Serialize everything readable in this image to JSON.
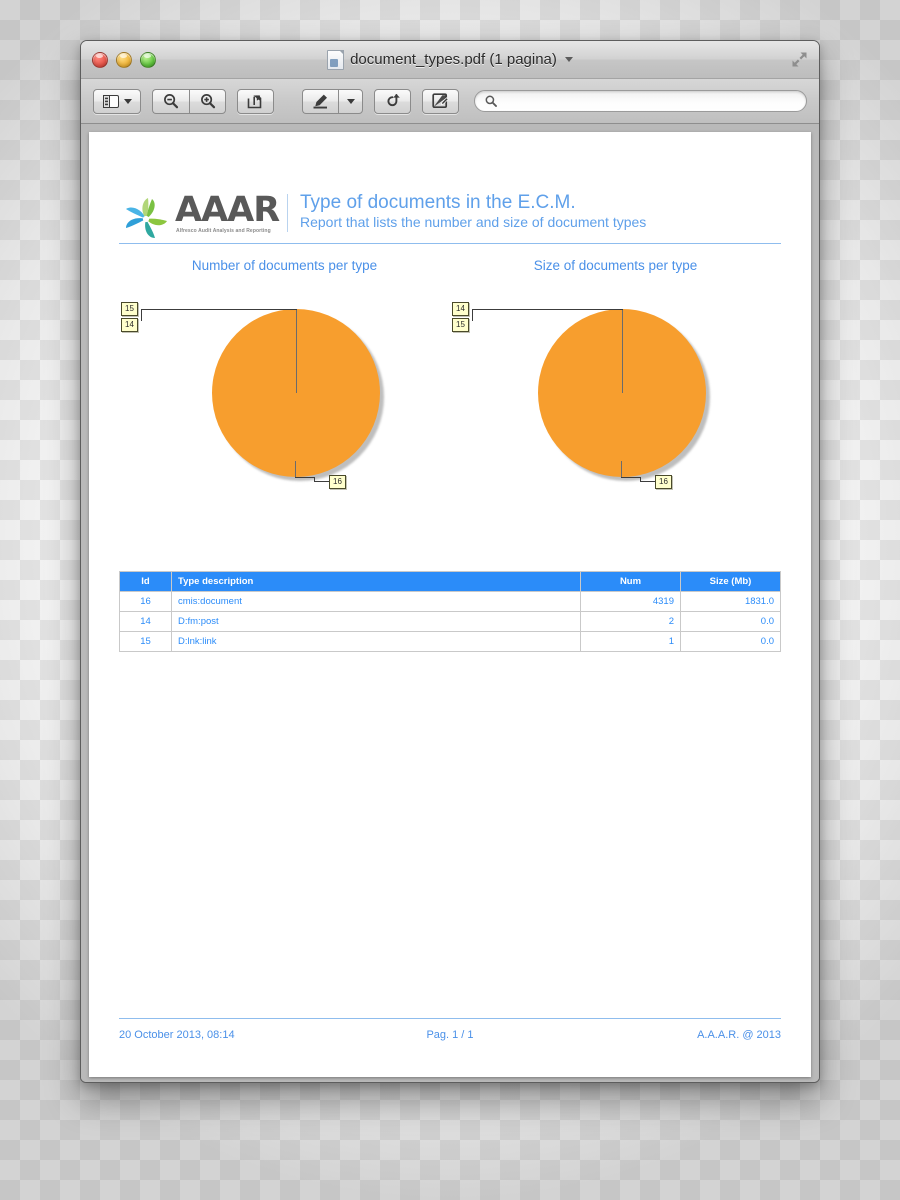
{
  "window": {
    "title": "document_types.pdf (1 pagina)",
    "title_icon": "pdf-document-icon",
    "title_chevron": "chevron-down-icon",
    "traffic_lights": [
      {
        "name": "close",
        "color": "#e8574c"
      },
      {
        "name": "minimize",
        "color": "#f0b63c"
      },
      {
        "name": "zoom",
        "color": "#62c63f"
      }
    ],
    "fullscreen_icon": "fullscreen-expand-icon"
  },
  "toolbar": {
    "sidebar_toggle_icon": "sidebar-panel-icon",
    "sidebar_caret_icon": "caret-down-icon",
    "zoom_out_icon": "magnifier-minus-icon",
    "zoom_in_icon": "magnifier-plus-icon",
    "share_icon": "share-arrow-icon",
    "markup_icon": "highlighter-pen-icon",
    "markup_caret_icon": "caret-down-icon",
    "rotate_icon": "rotate-left-icon",
    "annotate_icon": "edit-annotate-icon",
    "search": {
      "icon": "search-icon",
      "value": "",
      "placeholder": ""
    }
  },
  "report": {
    "logo": {
      "wordmark": "AAAR",
      "tagline": "Alfresco Audit Analysis and Reporting",
      "mark_icon": "pinwheel-flower-logo-icon",
      "petal_colors": [
        "#7ac143",
        "#57b6e5",
        "#29abe2",
        "#8cc63f",
        "#3fa9f5"
      ]
    },
    "title": "Type of documents in the E.C.M.",
    "subtitle": "Report that lists the number and size of document types",
    "chart_titles": [
      "Number of documents per type",
      "Size of documents per type"
    ],
    "table": {
      "headers": [
        "Id",
        "Type description",
        "Num",
        "Size (Mb)"
      ],
      "rows": [
        {
          "id": "16",
          "type": "cmis:document",
          "num": "4319",
          "size": "1831.0"
        },
        {
          "id": "14",
          "type": "D:fm:post",
          "num": "2",
          "size": "0.0"
        },
        {
          "id": "15",
          "type": "D:lnk:link",
          "num": "1",
          "size": "0.0"
        }
      ]
    },
    "footer": {
      "left": "20 October 2013, 08:14",
      "center": "Pag. 1 / 1",
      "right": "A.A.A.R. @ 2013"
    },
    "colors": {
      "brand_blue": "#4a90e8",
      "table_header_blue": "#2b8cf9",
      "pie_orange": "#f79e2e",
      "label_yellow": "#ffffcc"
    }
  },
  "chart_data": [
    {
      "type": "pie",
      "title": "Number of documents per type",
      "categories": [
        "16",
        "14",
        "15"
      ],
      "labels": [
        "16",
        "14",
        "15"
      ],
      "values": [
        4319,
        2,
        1
      ],
      "unit": "documents",
      "legend": "none",
      "callouts": [
        {
          "label": "15",
          "position": "top-left"
        },
        {
          "label": "14",
          "position": "top-left"
        },
        {
          "label": "16",
          "position": "bottom-right"
        }
      ],
      "slice_color": "#f79e2e"
    },
    {
      "type": "pie",
      "title": "Size of documents per type",
      "categories": [
        "16",
        "14",
        "15"
      ],
      "labels": [
        "16",
        "14",
        "15"
      ],
      "values": [
        1831.0,
        0.0,
        0.0
      ],
      "unit": "Mb",
      "legend": "none",
      "callouts": [
        {
          "label": "14",
          "position": "top-left"
        },
        {
          "label": "15",
          "position": "top-left"
        },
        {
          "label": "16",
          "position": "bottom-right"
        }
      ],
      "slice_color": "#f79e2e"
    }
  ]
}
